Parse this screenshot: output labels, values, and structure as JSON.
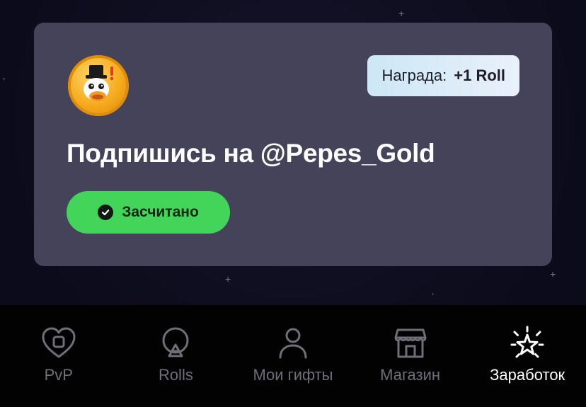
{
  "task": {
    "reward_label": "Награда:",
    "reward_value": "+1 Roll",
    "title": "Подпишись на @Pepes_Gold",
    "status_label": "Засчитано"
  },
  "tabbar": {
    "items": [
      {
        "label": "PvP",
        "icon": "heart-pvp-icon",
        "active": false
      },
      {
        "label": "Rolls",
        "icon": "roulette-icon",
        "active": false
      },
      {
        "label": "Мои гифты",
        "icon": "user-icon",
        "active": false
      },
      {
        "label": "Магазин",
        "icon": "store-icon",
        "active": false
      },
      {
        "label": "Заработок",
        "icon": "star-burst-icon",
        "active": true
      }
    ]
  },
  "colors": {
    "card": "#44435a",
    "success": "#43d45a",
    "active_tab": "#ffffff",
    "inactive_tab": "#6f6f78",
    "background": "#0d0c1d"
  }
}
